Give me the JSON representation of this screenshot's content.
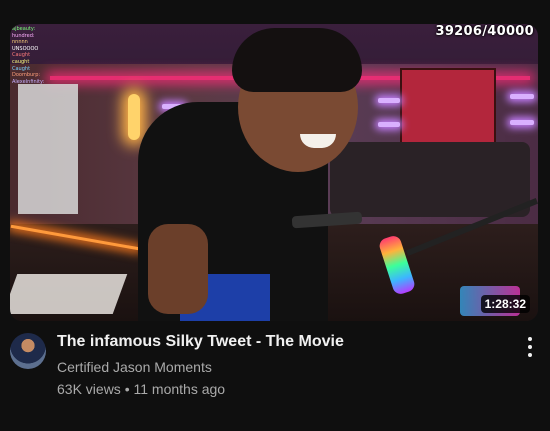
{
  "video": {
    "title": "The infamous Silky Tweet - The Movie",
    "channel": "Certified Jason Moments",
    "views": "63K views",
    "separator": "•",
    "age": "11 months ago",
    "duration": "1:28:32",
    "overlay_counter": "39206/40000"
  },
  "chat_overlay": [
    "ajbeauty:",
    "hundred:",
    "nnnnn",
    "UNSOOOO",
    "Caught",
    "caught",
    "Caught",
    "Doomburp:",
    "AlexeInfinity:"
  ],
  "colors": {
    "background": "#0f0f0f",
    "title": "#f1f1f1",
    "secondary_text": "#aaaaaa",
    "duration_badge": "#000000"
  }
}
